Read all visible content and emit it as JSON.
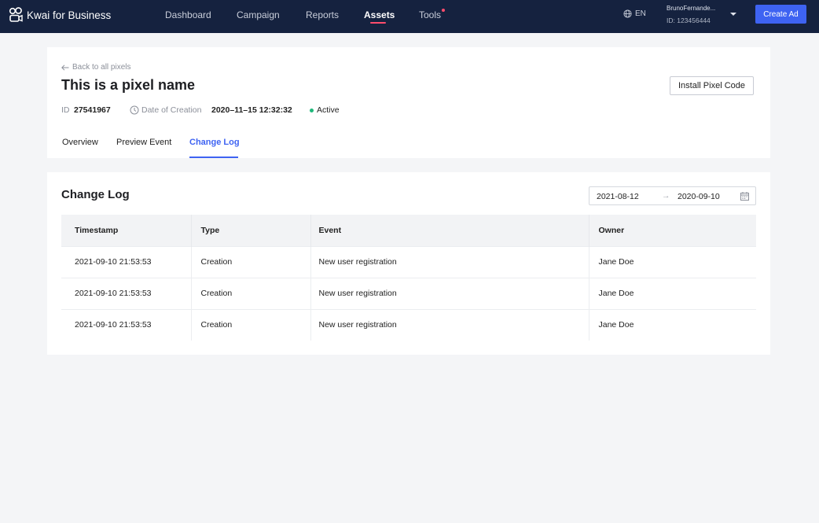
{
  "brand": {
    "name": "Kwai for Business",
    "icon": "kwai-logo-icon"
  },
  "nav": {
    "items": [
      {
        "label": "Dashboard"
      },
      {
        "label": "Campaign"
      },
      {
        "label": "Reports"
      },
      {
        "label": "Assets"
      },
      {
        "label": "Tools"
      }
    ],
    "active": "Assets",
    "accent": "#ff4d6d"
  },
  "lang": {
    "label": "EN",
    "icon": "globe-icon"
  },
  "user": {
    "name": "BrunoFernande...",
    "id": "ID: 123456444"
  },
  "create_ad": {
    "label": "Create Ad",
    "color": "#3e63f2"
  },
  "pixel": {
    "back_label": "Back to all pixels",
    "title": "This is a pixel name",
    "install_label": "Install Pixel Code",
    "id_label": "ID",
    "id_value": "27541967",
    "date_label": "Date of Creation",
    "date_value": "2020–11–15 12:32:32",
    "status": "Active",
    "status_color": "#1fb87b"
  },
  "tabs": [
    {
      "label": "Overview"
    },
    {
      "label": "Preview Event"
    },
    {
      "label": "Change Log"
    }
  ],
  "active_tab": "Change Log",
  "change_log": {
    "title": "Change Log",
    "date_start": "2021-08-12",
    "date_separator": "→",
    "date_end": "2020-09-10",
    "columns": [
      "Timestamp",
      "Type",
      "Event",
      "Owner"
    ],
    "rows": [
      {
        "timestamp": "2021-09-10 21:53:53",
        "type": "Creation",
        "event": "New user registration",
        "owner": "Jane Doe"
      },
      {
        "timestamp": "2021-09-10 21:53:53",
        "type": "Creation",
        "event": "New user registration",
        "owner": "Jane Doe"
      },
      {
        "timestamp": "2021-09-10 21:53:53",
        "type": "Creation",
        "event": "New user registration",
        "owner": "Jane Doe"
      }
    ]
  }
}
